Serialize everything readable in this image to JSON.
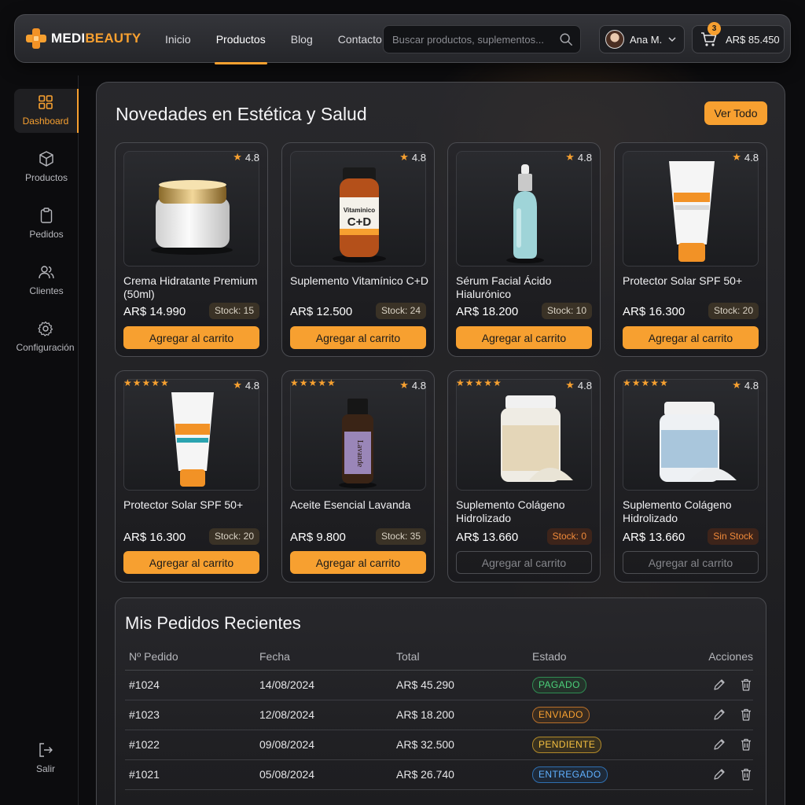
{
  "brand": {
    "name_part1": "MEDI",
    "name_part2": "BEAUTY"
  },
  "nav": {
    "items": [
      "Inicio",
      "Productos",
      "Blog",
      "Contacto"
    ],
    "active": "Productos"
  },
  "search": {
    "placeholder": "Buscar productos, suplementos...",
    "value": ""
  },
  "user": {
    "name": "Ana M."
  },
  "cart": {
    "count": "3",
    "total": "AR$ 85.450"
  },
  "sidebar": {
    "items": [
      {
        "label": "Dashboard",
        "icon": "grid-icon"
      },
      {
        "label": "Productos",
        "icon": "box-icon"
      },
      {
        "label": "Pedidos",
        "icon": "clipboard-icon"
      },
      {
        "label": "Clientes",
        "icon": "users-icon"
      },
      {
        "label": "Configuración",
        "icon": "gear-icon"
      }
    ],
    "logout": {
      "label": "Salir",
      "icon": "logout-icon"
    }
  },
  "products": {
    "title": "Novedades en Estética y Salud",
    "view_all": "Ver Todo",
    "items": [
      {
        "name": "Crema Hidratante Premium (50ml)",
        "price": "AR$ 14.990",
        "stock": "Stock: 15",
        "rating": "4.8",
        "button": "Agregar al carrito",
        "image": "cream-jar"
      },
      {
        "name": "Suplemento Vitamínico C+D",
        "price": "AR$ 12.500",
        "stock": "Stock: 24",
        "rating": "4.8",
        "button": "Agregar al carrito",
        "image": "vitamin-bottle",
        "label_line1": "Vitaminico",
        "label_line2": "C+D"
      },
      {
        "name": "Sérum Facial Ácido Hialurónico",
        "price": "AR$ 18.200",
        "stock": "Stock: 10",
        "rating": "4.8",
        "button": "Agregar al carrito",
        "image": "serum-dropper"
      },
      {
        "name": "Protector Solar SPF 50+",
        "price": "AR$ 16.300",
        "stock": "Stock: 20",
        "rating": "4.8",
        "button": "Agregar al carrito",
        "image": "sunscreen-tube"
      },
      {
        "name": "Protector Solar SPF 50+",
        "price": "AR$ 16.300",
        "stock": "Stock: 20",
        "rating": "4.8",
        "stars": "★★★★★",
        "button": "Agregar al carrito",
        "image": "sunscreen-tube"
      },
      {
        "name": "Aceite Esencial Lavanda",
        "price": "AR$ 9.800",
        "stock": "Stock: 35",
        "rating": "4.8",
        "stars": "★★★★★",
        "button": "Agregar al carrito",
        "image": "oil-bottle",
        "label_text": "Lavande"
      },
      {
        "name": "Suplemento Colágeno Hidrolizado",
        "price": "AR$ 13.660",
        "stock": "Stock: 0",
        "rating": "4.8",
        "stars": "★★★★★",
        "button": "Agregar al carrito",
        "disabled": true,
        "image": "collagen-jar-beige"
      },
      {
        "name": "Suplemento Colágeno Hidrolizado",
        "price": "AR$ 13.660",
        "stock": "Sin Stock",
        "rating": "4.8",
        "stars": "★★★★★",
        "button": "Agregar al carrito",
        "disabled": true,
        "image": "collagen-jar-blue"
      }
    ]
  },
  "orders": {
    "title": "Mis Pedidos Recientes",
    "columns": [
      "Nº Pedido",
      "Fecha",
      "Total",
      "Estado",
      "Acciones"
    ],
    "rows": [
      {
        "id": "#1024",
        "date": "14/08/2024",
        "total": "AR$ 45.290",
        "status": "PAGADO",
        "status_class": "st-pagado"
      },
      {
        "id": "#1023",
        "date": "12/08/2024",
        "total": "AR$ 18.200",
        "status": "ENVIADO",
        "status_class": "st-enviado"
      },
      {
        "id": "#1022",
        "date": "09/08/2024",
        "total": "AR$ 32.500",
        "status": "PENDIENTE",
        "status_class": "st-pendiente"
      },
      {
        "id": "#1021",
        "date": "05/08/2024",
        "total": "AR$ 26.740",
        "status": "ENTREGADO",
        "status_class": "st-entregado"
      }
    ],
    "row_actions": [
      "edit-icon",
      "trash-icon"
    ]
  },
  "colors": {
    "accent": "#f7a030",
    "background": "#0c0c0e",
    "panel": "#2a2a2e",
    "success": "#4cd07a",
    "info": "#5fb0ff",
    "warning": "#f5c040"
  }
}
